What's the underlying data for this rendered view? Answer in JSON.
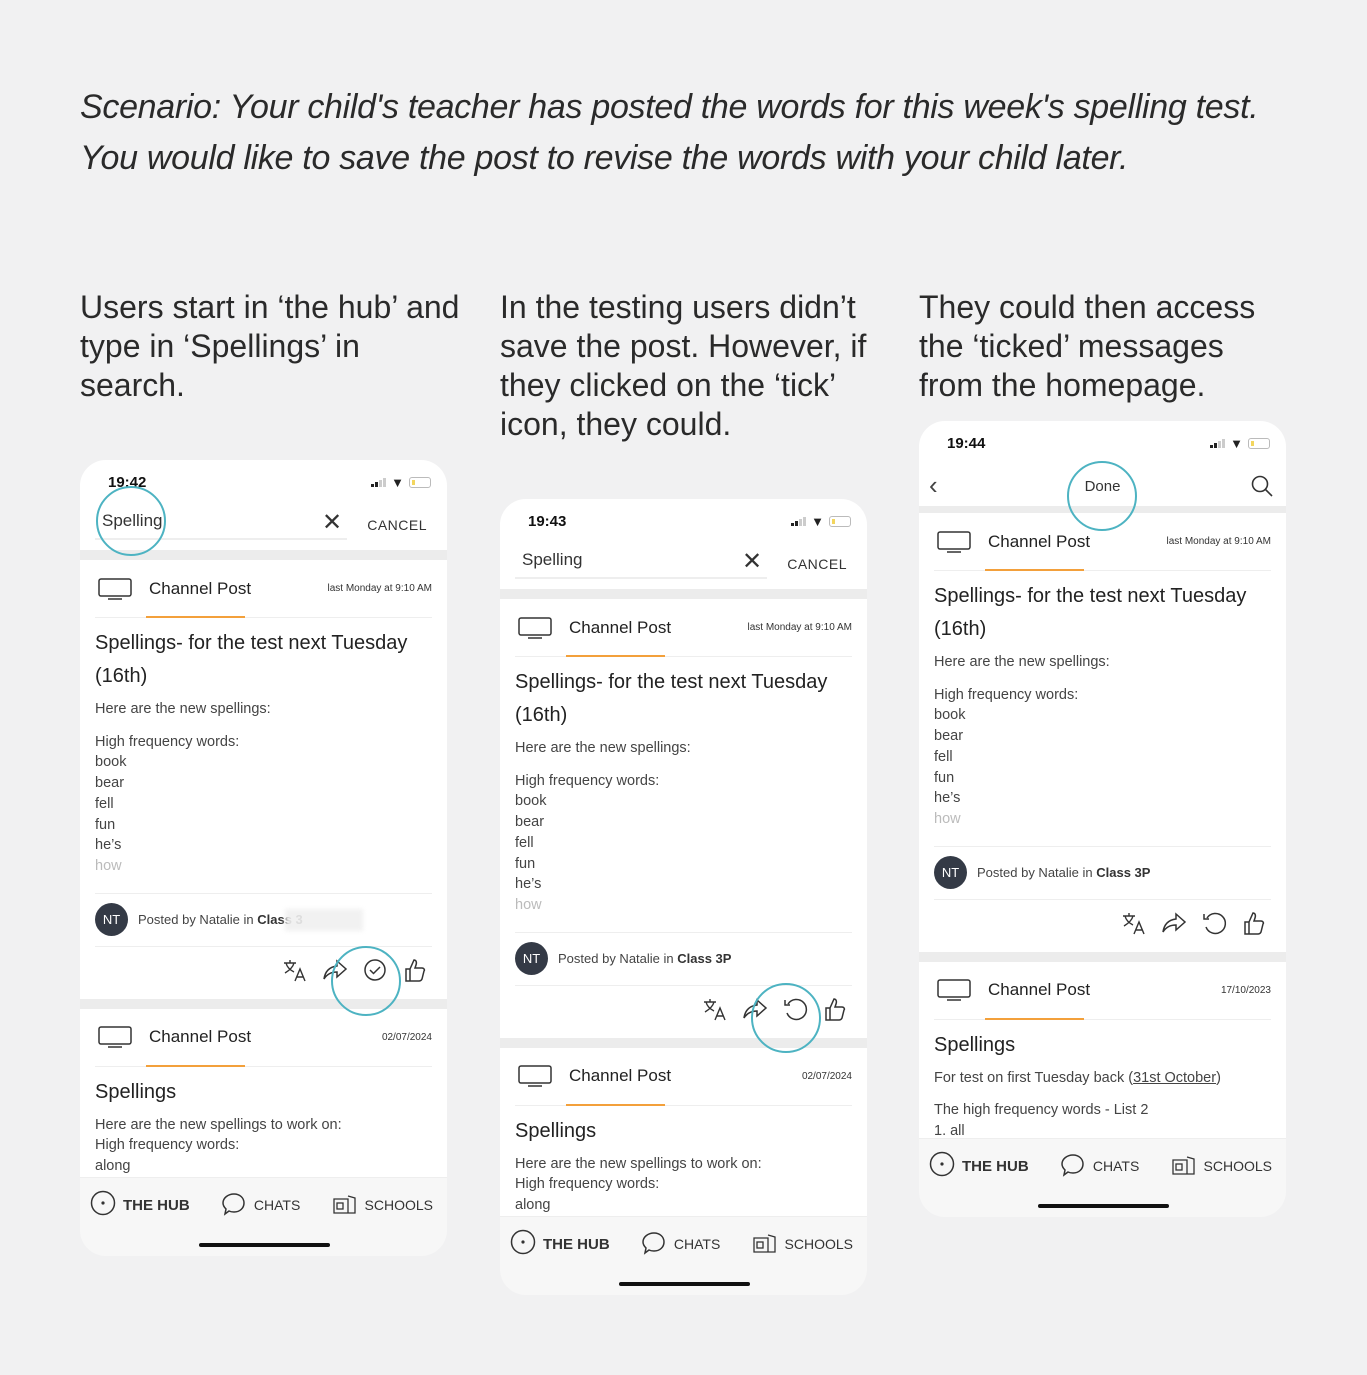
{
  "scenario": "Scenario: Your child's teacher has posted the words for this week's spelling test. You would like to save the post to revise the words with your child later.",
  "captions": [
    "Users start in ‘the hub’ and type in ‘Spellings’ in search.",
    "In the testing users didn’t save the post. However, if they clicked on the ‘tick’ icon, they could.",
    "They could then access the ‘ticked’ messages from the homepage."
  ],
  "colors": {
    "highlight": "#4db3c2",
    "accent": "#f3a03b",
    "avatar": "#343a46"
  },
  "phones": [
    {
      "time": "19:42",
      "header": "search",
      "search_value": "Spelling",
      "cancel_label": "CANCEL",
      "blur_class": true,
      "action_icon": "check-circle-icon",
      "cards": [
        {
          "type_label": "Channel Post",
          "date": "last Monday at 9:10 AM",
          "title": "Spellings- for the test next Tuesday (16th)",
          "intro": "Here are the new spellings:",
          "list_heading": "High frequency words:",
          "words": [
            "book",
            "bear",
            "fell",
            "fun",
            "he’s"
          ],
          "faded_word": "how",
          "posted_prefix": "Posted by Natalie in ",
          "class_name": "Class 3P"
        },
        {
          "type_label": "Channel Post",
          "date": "02/07/2024",
          "title": "Spellings",
          "lines": [
            "Here are the new spellings to work on:",
            "High frequency words:",
            "along"
          ]
        }
      ]
    },
    {
      "time": "19:43",
      "header": "search",
      "search_value": "Spelling",
      "cancel_label": "CANCEL",
      "blur_class": false,
      "action_icon": "refresh-icon",
      "cards": [
        {
          "type_label": "Channel Post",
          "date": "last Monday at 9:10 AM",
          "title": "Spellings- for the test next Tuesday (16th)",
          "intro": "Here are the new spellings:",
          "list_heading": "High frequency words:",
          "words": [
            "book",
            "bear",
            "fell",
            "fun",
            "he’s"
          ],
          "faded_word": "how",
          "posted_prefix": "Posted by Natalie in ",
          "class_name": "Class 3P"
        },
        {
          "type_label": "Channel Post",
          "date": "02/07/2024",
          "title": "Spellings",
          "lines": [
            "Here are the new spellings to work on:",
            "High frequency words:",
            "along"
          ]
        }
      ]
    },
    {
      "time": "19:44",
      "header": "nav",
      "done_label": "Done",
      "blur_class": false,
      "action_icon": "refresh-icon",
      "cards": [
        {
          "type_label": "Channel Post",
          "date": "last Monday at 9:10 AM",
          "title": "Spellings- for the test next Tuesday (16th)",
          "intro": "Here are the new spellings:",
          "list_heading": "High frequency words:",
          "words": [
            "book",
            "bear",
            "fell",
            "fun",
            "he’s"
          ],
          "faded_word": "how",
          "posted_prefix": "Posted by Natalie in ",
          "class_name": "Class 3P"
        },
        {
          "type_label": "Channel Post",
          "date": "17/10/2023",
          "title": "Spellings",
          "text_before": "For test on first Tuesday back (",
          "link": "31st October",
          "text_after": ")",
          "lines2": [
            "The high frequency words - List 2",
            "1. all"
          ]
        }
      ]
    }
  ],
  "bottom_nav": [
    {
      "label": "THE HUB",
      "icon": "hub-icon"
    },
    {
      "label": "CHATS",
      "icon": "chat-bubble-icon"
    },
    {
      "label": "SCHOOLS",
      "icon": "school-building-icon"
    }
  ]
}
